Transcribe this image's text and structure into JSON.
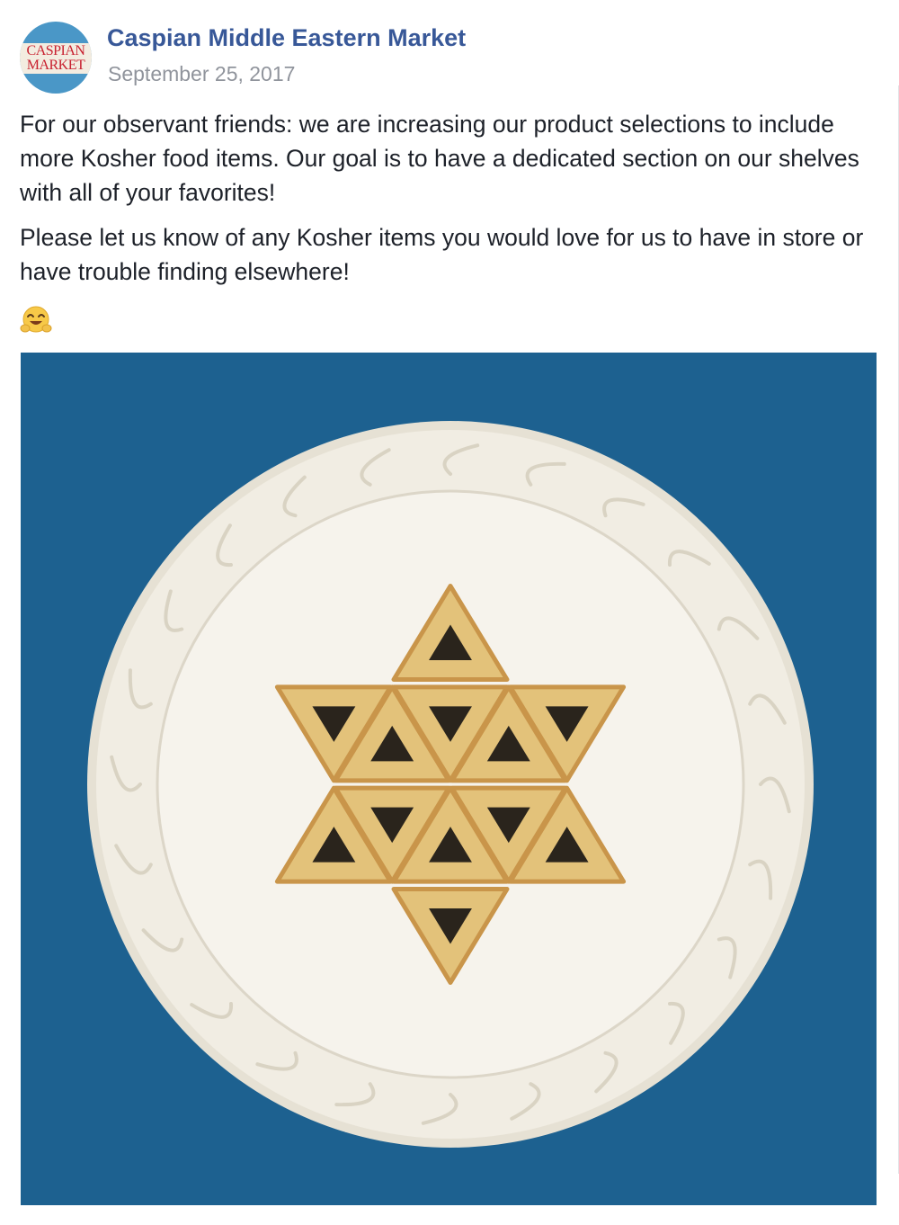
{
  "post": {
    "page_name": "Caspian Middle Eastern Market",
    "date": "September 25, 2017",
    "avatar": {
      "line1": "CASPIAN",
      "line2": "MARKET"
    },
    "paragraphs": [
      "For our observant friends: we are increasing our product selections to include more Kosher food items. Our goal is to have a dedicated section on our shelves with all of your favorites!",
      "Please let us know of any Kosher items you would love for us to have in store or have trouble finding elsewhere!"
    ],
    "emoji": "hugging-face-emoji",
    "photo": {
      "subject": "hamantaschen-star-on-plate"
    }
  },
  "colors": {
    "link": "#385898",
    "meta": "#90949c",
    "photo_background": "#1d6190",
    "pastry": "#e3c27a",
    "filling": "#2a241c",
    "plate": "#f1ede3"
  }
}
